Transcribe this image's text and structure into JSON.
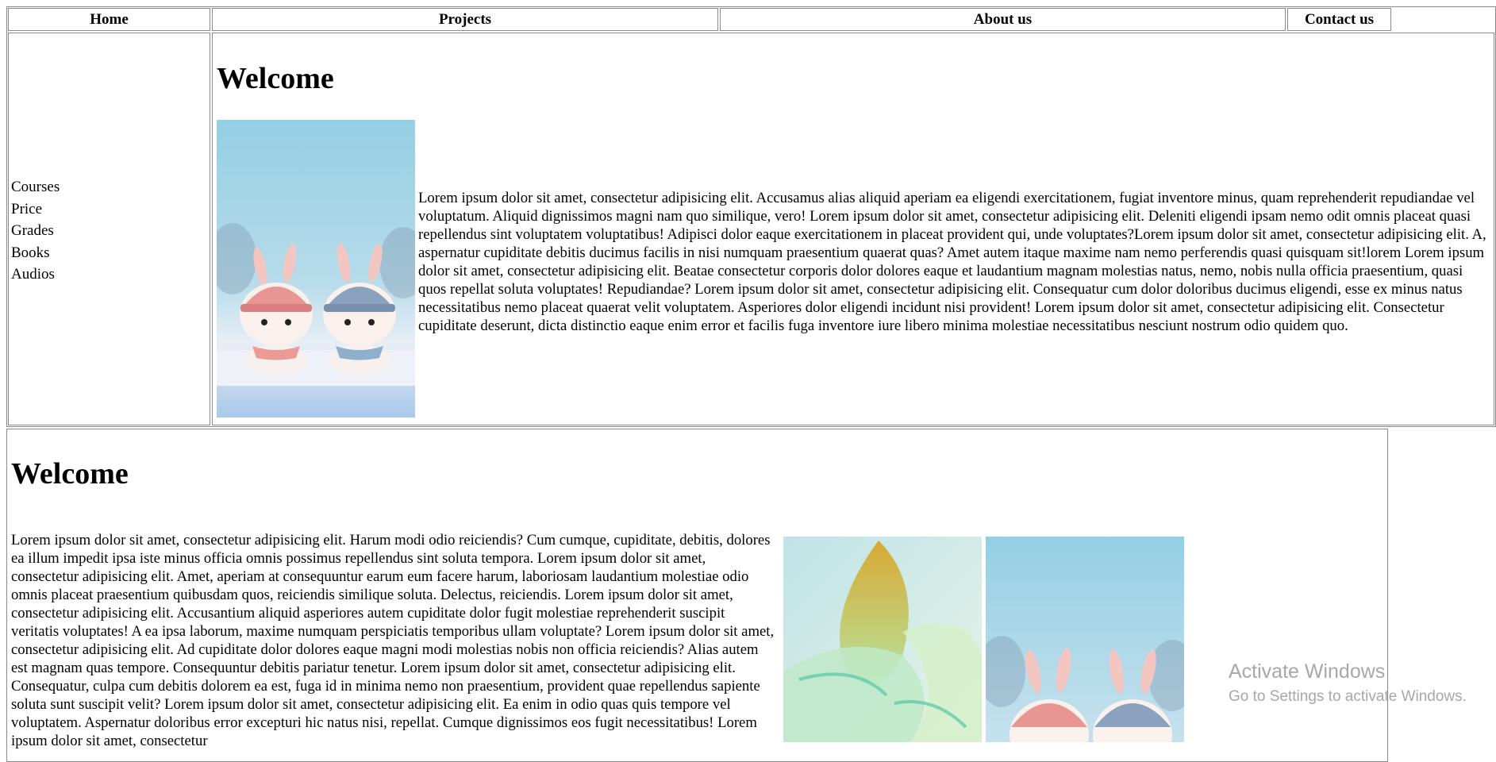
{
  "nav": {
    "items": [
      {
        "label": "Home"
      },
      {
        "label": "Projects"
      },
      {
        "label": "About us"
      },
      {
        "label": "Contact us"
      }
    ]
  },
  "sidebar": {
    "items": [
      {
        "label": "Courses"
      },
      {
        "label": "Price"
      },
      {
        "label": "Grades"
      },
      {
        "label": "Books"
      },
      {
        "label": "Audios"
      }
    ]
  },
  "top_section": {
    "heading": "Welcome",
    "image_icon": "bunnies-image",
    "paragraph": "Lorem ipsum dolor sit amet, consectetur adipisicing elit. Accusamus alias aliquid aperiam ea eligendi exercitationem, fugiat inventore minus, quam reprehenderit repudiandae vel voluptatum. Aliquid dignissimos magni nam quo similique, vero! Lorem ipsum dolor sit amet, consectetur adipisicing elit. Deleniti eligendi ipsam nemo odit omnis placeat quasi repellendus sint voluptatem voluptatibus! Adipisci dolor eaque exercitationem in placeat provident qui, unde voluptates?Lorem ipsum dolor sit amet, consectetur adipisicing elit. A, aspernatur cupiditate debitis ducimus facilis in nisi numquam praesentium quaerat quas? Amet autem itaque maxime nam nemo perferendis quasi quisquam sit!lorem Lorem ipsum dolor sit amet, consectetur adipisicing elit. Beatae consectetur corporis dolor dolores eaque et laudantium magnam molestias natus, nemo, nobis nulla officia praesentium, quasi quos repellat soluta voluptates! Repudiandae? Lorem ipsum dolor sit amet, consectetur adipisicing elit. Consequatur cum dolor doloribus ducimus eligendi, esse ex minus natus necessitatibus nemo placeat quaerat velit voluptatem. Asperiores dolor eligendi incidunt nisi provident! Lorem ipsum dolor sit amet, consectetur adipisicing elit. Consectetur cupiditate deserunt, dicta distinctio eaque enim error et facilis fuga inventore iure libero minima molestiae necessitatibus nesciunt nostrum odio quidem quo."
  },
  "bottom_section": {
    "heading": "Welcome",
    "paragraph": "Lorem ipsum dolor sit amet, consectetur adipisicing elit. Harum modi odio reiciendis? Cum cumque, cupiditate, debitis, dolores ea illum impedit ipsa iste minus officia omnis possimus repellendus sint soluta tempora. Lorem ipsum dolor sit amet, consectetur adipisicing elit. Amet, aperiam at consequuntur earum eum facere harum, laboriosam laudantium molestiae odio omnis placeat praesentium quibusdam quos, reiciendis similique soluta. Delectus, reiciendis. Lorem ipsum dolor sit amet, consectetur adipisicing elit. Accusantium aliquid asperiores autem cupiditate dolor fugit molestiae reprehenderit suscipit veritatis voluptates! A ea ipsa laborum, maxime numquam perspiciatis temporibus ullam voluptate? Lorem ipsum dolor sit amet, consectetur adipisicing elit. Ad cupiditate dolor dolores eaque magni modi molestias nobis non officia reiciendis? Alias autem est magnam quas tempore. Consequuntur debitis pariatur tenetur. Lorem ipsum dolor sit amet, consectetur adipisicing elit. Consequatur, culpa cum debitis dolorem ea est, fuga id in minima nemo non praesentium, provident quae repellendus sapiente soluta sunt suscipit velit? Lorem ipsum dolor sit amet, consectetur adipisicing elit. Ea enim in odio quas quis tempore vel voluptatem. Aspernatur doloribus error excepturi hic natus nisi, repellat. Cumque dignissimos eos fugit necessitatibus! Lorem ipsum dolor sit amet, consectetur",
    "images": [
      {
        "icon": "flower-image"
      },
      {
        "icon": "bunnies-image"
      }
    ]
  },
  "watermark": {
    "title": "Activate Windows",
    "subtitle": "Go to Settings to activate Windows."
  },
  "colors": {
    "border": "#8a8a8a",
    "sky": "#94cfe3",
    "watermark": "#a7a7a7"
  }
}
